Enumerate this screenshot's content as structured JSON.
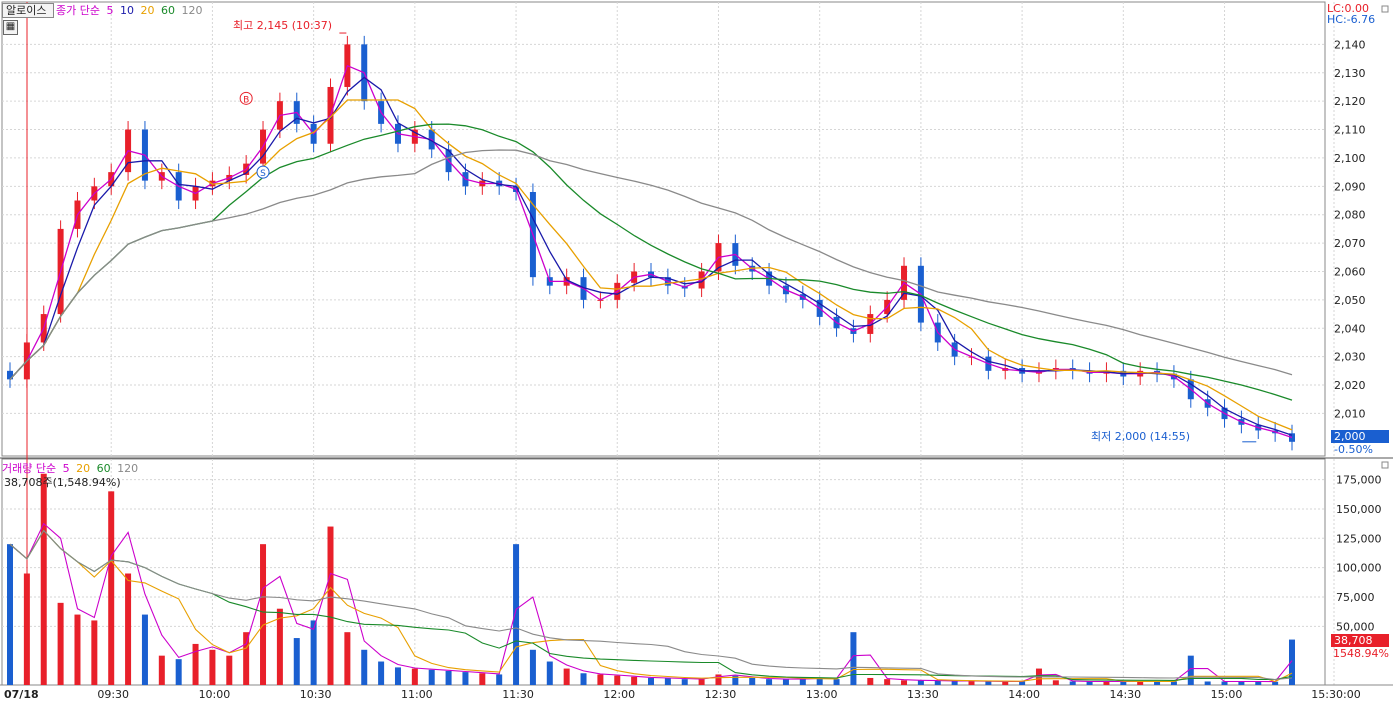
{
  "symbol": "알로이스",
  "price_legend": {
    "label": "종가 단순",
    "periods": [
      "5",
      "10",
      "20",
      "60",
      "120"
    ],
    "colors": [
      "#cc00cc",
      "#1a1aaa",
      "#e8a000",
      "#1a8a2a",
      "#8a8a8a"
    ]
  },
  "volume_legend": {
    "label": "거래량 단순",
    "periods": [
      "5",
      "20",
      "60",
      "120"
    ],
    "colors": [
      "#cc00cc",
      "#e8a000",
      "#1a8a2a",
      "#8a8a8a"
    ],
    "current": "38,708주(1,548.94%)"
  },
  "top_right": {
    "lc": "LC:0.00",
    "hc": "HC:-6.76"
  },
  "high_annotation": "최고 2,145 (10:37)",
  "low_annotation": "최저 2,000 (14:55)",
  "signals": {
    "buy": "B",
    "sell": "S"
  },
  "current_price": {
    "value": "2,000",
    "change": "-0.50%"
  },
  "current_volume": {
    "value": "38,708",
    "ratio": "1548.94%"
  },
  "colors": {
    "up": "#e8202a",
    "down": "#1a5fd0",
    "grid": "#d6d6d6",
    "price_box": "#1a5fd0",
    "vol_box": "#e8202a"
  },
  "x_axis": {
    "date": "07/18",
    "ticks": [
      "09:30",
      "10:00",
      "10:30",
      "11:00",
      "11:30",
      "12:00",
      "12:30",
      "13:00",
      "13:30",
      "14:00",
      "14:30",
      "15:00",
      "15:30:00"
    ]
  },
  "chart_data": [
    {
      "type": "candlestick",
      "name": "price",
      "ylim": [
        1995,
        2150
      ],
      "y_ticks": [
        "2,010",
        "2,020",
        "2,030",
        "2,040",
        "2,050",
        "2,060",
        "2,070",
        "2,080",
        "2,090",
        "2,100",
        "2,110",
        "2,120",
        "2,130",
        "2,140"
      ],
      "y_tick_values": [
        2010,
        2020,
        2030,
        2040,
        2050,
        2060,
        2070,
        2080,
        2090,
        2100,
        2110,
        2120,
        2130,
        2140
      ],
      "x": [
        "09:00",
        "09:05",
        "09:10",
        "09:15",
        "09:20",
        "09:25",
        "09:30",
        "09:35",
        "09:40",
        "09:45",
        "09:50",
        "09:55",
        "10:00",
        "10:05",
        "10:10",
        "10:15",
        "10:20",
        "10:25",
        "10:30",
        "10:35",
        "10:40",
        "10:45",
        "10:50",
        "10:55",
        "11:00",
        "11:05",
        "11:10",
        "11:15",
        "11:20",
        "11:25",
        "11:30",
        "11:35",
        "11:40",
        "11:45",
        "11:50",
        "11:55",
        "12:00",
        "12:05",
        "12:10",
        "12:15",
        "12:20",
        "12:25",
        "12:30",
        "12:35",
        "12:40",
        "12:45",
        "12:50",
        "12:55",
        "13:00",
        "13:05",
        "13:10",
        "13:15",
        "13:20",
        "13:25",
        "13:30",
        "13:35",
        "13:40",
        "13:45",
        "13:50",
        "13:55",
        "14:00",
        "14:05",
        "14:10",
        "14:15",
        "14:20",
        "14:25",
        "14:30",
        "14:35",
        "14:40",
        "14:45",
        "14:50",
        "14:55",
        "15:00",
        "15:05",
        "15:10",
        "15:15",
        "15:20"
      ],
      "close": [
        2022,
        2035,
        2045,
        2075,
        2085,
        2090,
        2095,
        2110,
        2092,
        2095,
        2085,
        2090,
        2092,
        2094,
        2098,
        2110,
        2120,
        2112,
        2105,
        2125,
        2140,
        2120,
        2112,
        2105,
        2110,
        2103,
        2095,
        2090,
        2092,
        2090,
        2088,
        2058,
        2055,
        2058,
        2050,
        2050,
        2056,
        2060,
        2058,
        2055,
        2054,
        2060,
        2070,
        2062,
        2060,
        2055,
        2052,
        2050,
        2044,
        2040,
        2038,
        2045,
        2050,
        2062,
        2042,
        2035,
        2030,
        2030,
        2025,
        2026,
        2024,
        2025,
        2026,
        2025,
        2024,
        2025,
        2023,
        2025,
        2024,
        2022,
        2015,
        2012,
        2008,
        2006,
        2004,
        2003,
        2000
      ],
      "source_note": ""
    },
    {
      "type": "bar",
      "name": "volume",
      "ylim": [
        0,
        190000
      ],
      "y_ticks": [
        "50,000",
        "75,000",
        "100,000",
        "125,000",
        "150,000",
        "175,000"
      ],
      "y_tick_values": [
        50000,
        75000,
        100000,
        125000,
        150000,
        175000
      ],
      "values": [
        120000,
        95000,
        180000,
        70000,
        60000,
        55000,
        165000,
        95000,
        60000,
        25000,
        22000,
        35000,
        30000,
        25000,
        45000,
        120000,
        65000,
        40000,
        55000,
        135000,
        45000,
        30000,
        20000,
        15000,
        14000,
        13000,
        12000,
        11000,
        10000,
        9000,
        120000,
        30000,
        20000,
        14000,
        10000,
        9000,
        8000,
        7000,
        6000,
        6000,
        5000,
        5000,
        9000,
        8000,
        6000,
        5000,
        5000,
        5000,
        6000,
        5000,
        45000,
        6000,
        5000,
        4000,
        4000,
        3500,
        3500,
        3500,
        3000,
        3000,
        3000,
        14000,
        4000,
        3000,
        3000,
        3000,
        3000,
        3000,
        3000,
        3000,
        25000,
        3000,
        3000,
        3000,
        3000,
        2800,
        38708
      ]
    }
  ]
}
